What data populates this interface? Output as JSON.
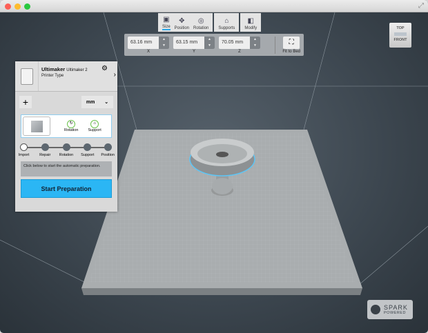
{
  "window": {
    "title": ""
  },
  "toolbar": {
    "items": [
      {
        "label": "Size",
        "icon": "size-icon",
        "active": true
      },
      {
        "label": "Position",
        "icon": "move-icon"
      },
      {
        "label": "Rotation",
        "icon": "rotation-icon"
      },
      {
        "label": "Supports",
        "icon": "supports-icon"
      },
      {
        "label": "Modify",
        "icon": "modify-icon"
      }
    ]
  },
  "size": {
    "x": "63.16 mm",
    "y": "63.15 mm",
    "z": "70.05 mm",
    "x_label": "X",
    "y_label": "Y",
    "z_label": "Z",
    "fit_label": "Fit to Bed"
  },
  "printer": {
    "brand": "Ultimaker",
    "model": "Ultimaker 2",
    "type": "Printer Type"
  },
  "units": {
    "value": "mm"
  },
  "modes": {
    "rotation": "Rotation",
    "support": "Support"
  },
  "steps": [
    "Import",
    "Repair",
    "Rotation",
    "Support",
    "Position"
  ],
  "message": "Click below to start the automatic preparation.",
  "start_label": "Start Preparation",
  "viewcube": {
    "top": "TOP",
    "front": "FRONT"
  },
  "branding": {
    "line1": "SPARK",
    "line2": "POWERED"
  },
  "colors": {
    "accent": "#2bb6f4",
    "background": "#3d4750",
    "mode_ring": "#6ac14b"
  }
}
